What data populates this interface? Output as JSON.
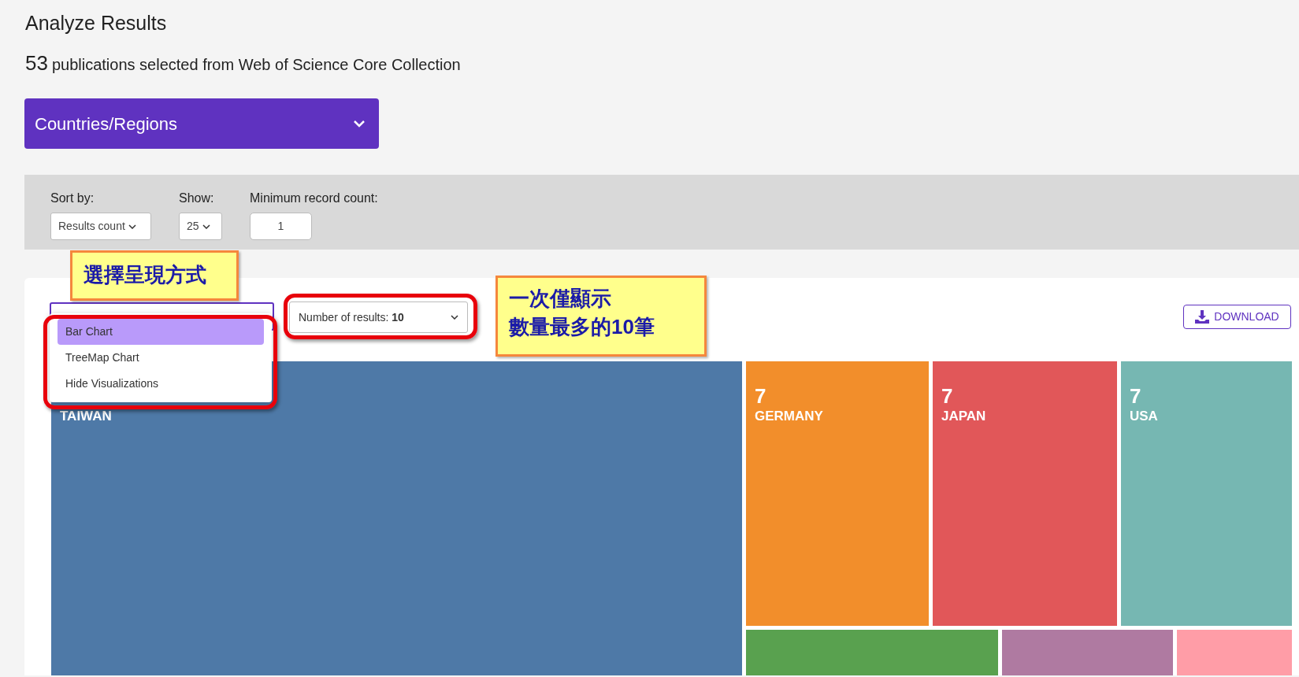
{
  "page": {
    "title": "Analyze Results",
    "count": "53",
    "summary": "publications selected from Web of Science Core Collection"
  },
  "field_selector": {
    "label": "Countries/Regions"
  },
  "filters": [
    {
      "kind": "select",
      "label": "Sort by:",
      "value": "Results count"
    },
    {
      "kind": "select",
      "label": "Show:",
      "value": "25"
    },
    {
      "kind": "input",
      "label": "Minimum record count:",
      "value": "1"
    }
  ],
  "visualization_menu": {
    "options": [
      {
        "label": "Bar Chart",
        "selected": true
      },
      {
        "label": "TreeMap Chart",
        "selected": false
      },
      {
        "label": "Hide Visualizations",
        "selected": false
      }
    ]
  },
  "results_select": {
    "label": "Number of results:",
    "value": "10"
  },
  "download_button": {
    "label": "DOWNLOAD"
  },
  "treemap": {
    "tiles": [
      {
        "label": "TAIWAN",
        "color": "#4e79a7"
      },
      {
        "count": "7",
        "label": "GERMANY",
        "color": "#f28e2b"
      },
      {
        "count": "7",
        "label": "JAPAN",
        "color": "#e15759"
      },
      {
        "count": "7",
        "label": "USA",
        "color": "#76b7b2"
      },
      {
        "color": "#59a14f"
      },
      {
        "color": "#af7aa1"
      },
      {
        "color": "#ff9da7"
      }
    ]
  },
  "callouts": [
    {
      "lines": [
        "選擇呈現方式"
      ]
    },
    {
      "lines": [
        "一次僅顯示",
        "數量最多的10筆"
      ]
    }
  ]
}
